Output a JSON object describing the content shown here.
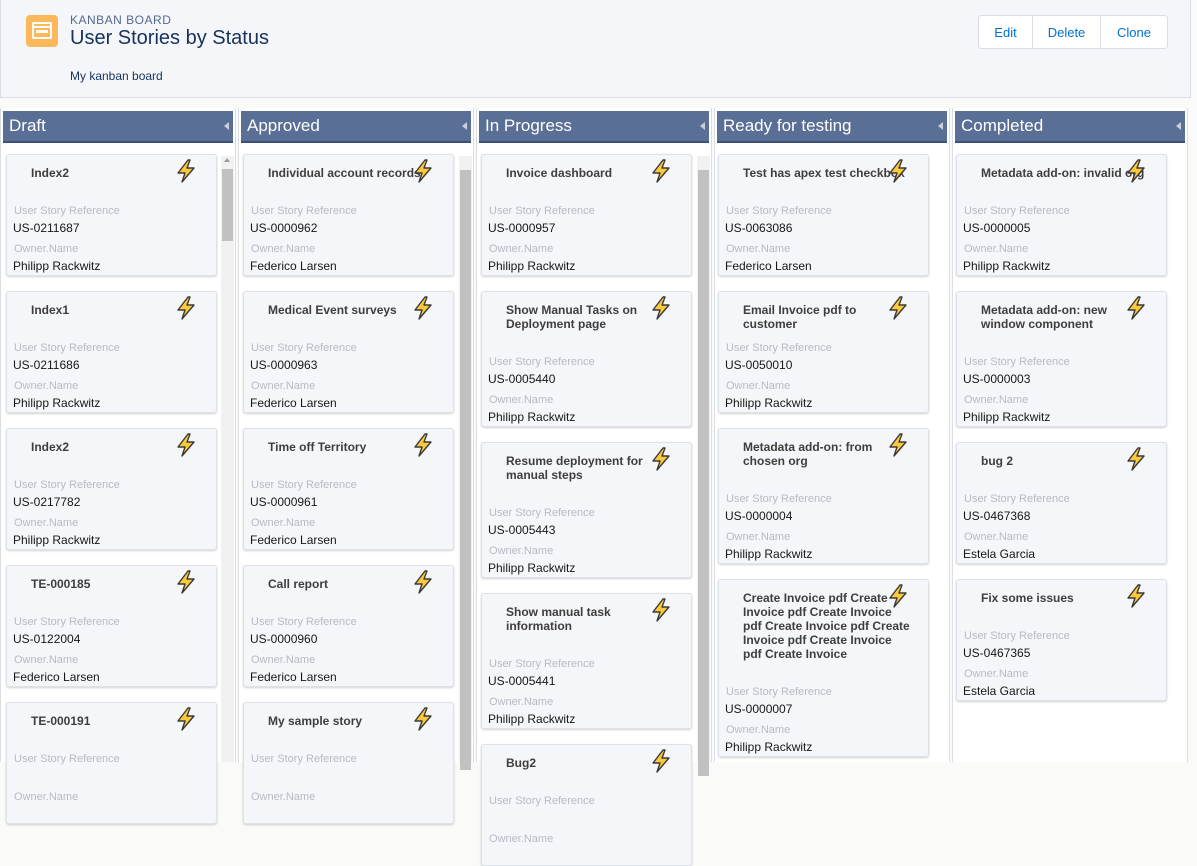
{
  "header": {
    "eyebrow": "KANBAN BOARD",
    "title": "User Stories by Status",
    "description": "My kanban board",
    "buttons": {
      "edit": "Edit",
      "delete": "Delete",
      "clone": "Clone"
    }
  },
  "colors": {
    "column_header": "#5a6f96",
    "bolt_fill": "#fcc93a",
    "accent": "#0070d2",
    "header_icon": "#fcb95b"
  },
  "labels": {
    "reference": "User Story Reference",
    "owner": "Owner.Name"
  },
  "columns": [
    {
      "name": "Draft",
      "cards": [
        {
          "title": "Index2",
          "reference": "US-0211687",
          "owner": "Philipp Rackwitz"
        },
        {
          "title": "Index1",
          "reference": "US-0211686",
          "owner": "Philipp Rackwitz"
        },
        {
          "title": "Index2",
          "reference": "US-0217782",
          "owner": "Philipp Rackwitz"
        },
        {
          "title": "TE-000185",
          "reference": "US-0122004",
          "owner": "Federico Larsen"
        },
        {
          "title": "TE-000191",
          "reference": "",
          "owner": ""
        }
      ]
    },
    {
      "name": "Approved",
      "cards": [
        {
          "title": "Individual account records",
          "reference": "US-0000962",
          "owner": "Federico Larsen"
        },
        {
          "title": "Medical Event surveys",
          "reference": "US-0000963",
          "owner": "Federico Larsen"
        },
        {
          "title": "Time off Territory",
          "reference": "US-0000961",
          "owner": "Federico Larsen"
        },
        {
          "title": "Call report",
          "reference": "US-0000960",
          "owner": "Federico Larsen"
        },
        {
          "title": "My sample story",
          "reference": "",
          "owner": ""
        }
      ]
    },
    {
      "name": "In Progress",
      "cards": [
        {
          "title": "Invoice dashboard",
          "reference": "US-0000957",
          "owner": "Philipp Rackwitz"
        },
        {
          "title": "Show Manual Tasks on Deployment page",
          "reference": "US-0005440",
          "owner": "Philipp Rackwitz"
        },
        {
          "title": "Resume deployment for manual steps",
          "reference": "US-0005443",
          "owner": "Philipp Rackwitz"
        },
        {
          "title": "Show manual task information",
          "reference": "US-0005441",
          "owner": "Philipp Rackwitz"
        },
        {
          "title": "Bug2",
          "reference": "",
          "owner": ""
        }
      ]
    },
    {
      "name": "Ready for testing",
      "cards": [
        {
          "title": "Test has apex test checkbox",
          "reference": "US-0063086",
          "owner": "Federico Larsen"
        },
        {
          "title": "Email Invoice pdf to customer",
          "reference": "US-0050010",
          "owner": "Philipp Rackwitz"
        },
        {
          "title": "Metadata add-on: from chosen org",
          "reference": "US-0000004",
          "owner": "Philipp Rackwitz"
        },
        {
          "title": "Create Invoice pdf Create Invoice pdf Create Invoice pdf Create Invoice pdf Create Invoice pdf Create Invoice pdf Create Invoice",
          "reference": "US-0000007",
          "owner": "Philipp Rackwitz"
        }
      ]
    },
    {
      "name": "Completed",
      "cards": [
        {
          "title": "Metadata add-on: invalid org",
          "reference": "US-0000005",
          "owner": "Philipp Rackwitz"
        },
        {
          "title": "Metadata add-on: new window component",
          "reference": "US-0000003",
          "owner": "Philipp Rackwitz"
        },
        {
          "title": "bug 2",
          "reference": "US-0467368",
          "owner": "Estela Garcia"
        },
        {
          "title": "Fix some issues",
          "reference": "US-0467365",
          "owner": "Estela Garcia"
        }
      ]
    }
  ]
}
